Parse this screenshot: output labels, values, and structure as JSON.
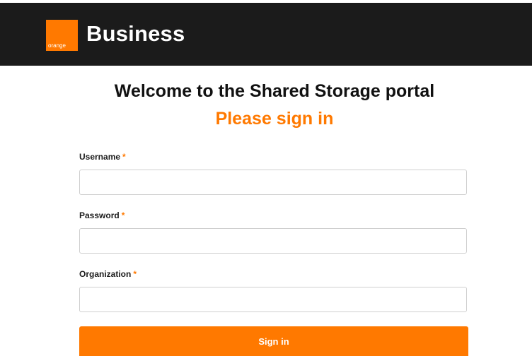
{
  "header": {
    "logo_text": "orange",
    "brand": "Business"
  },
  "main": {
    "welcome": "Welcome to the Shared Storage portal",
    "subtitle": "Please sign in"
  },
  "form": {
    "required_marker": "*",
    "username": {
      "label": "Username",
      "value": "",
      "placeholder": ""
    },
    "password": {
      "label": "Password",
      "value": "",
      "placeholder": ""
    },
    "organization": {
      "label": "Organization",
      "value": "",
      "placeholder": ""
    },
    "submit_label": "Sign in"
  },
  "colors": {
    "accent": "#ff7900",
    "header_bg": "#1b1b1b",
    "text": "#111111"
  }
}
